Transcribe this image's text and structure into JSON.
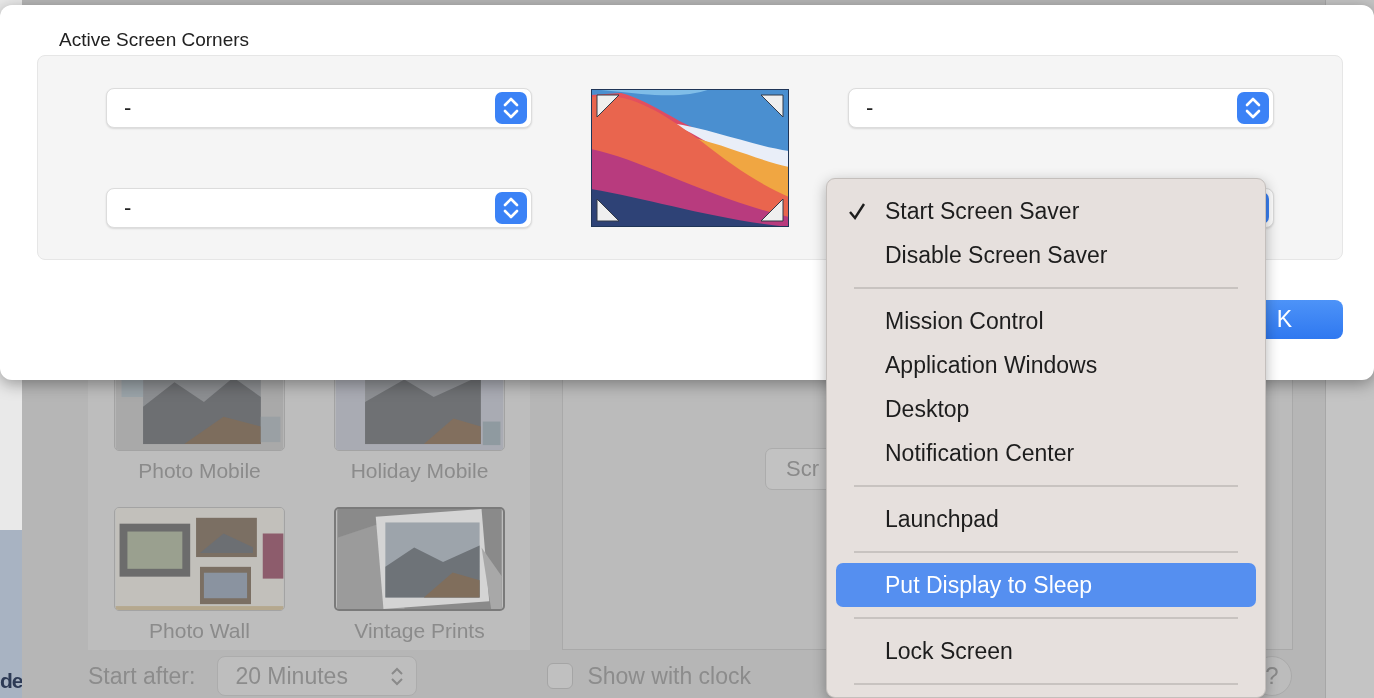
{
  "background": {
    "sidebar_text": "de",
    "savers": [
      {
        "label": "Photo Mobile",
        "selected": false
      },
      {
        "label": "Holiday Mobile",
        "selected": false
      },
      {
        "label": "Photo Wall",
        "selected": false
      },
      {
        "label": "Vintage Prints",
        "selected": true
      }
    ],
    "preview_button": "Scr",
    "start_after": {
      "label": "Start after:",
      "value": "20 Minutes"
    },
    "show_with_clock": {
      "label": "Show with clock",
      "checked": false
    },
    "help_button": "?"
  },
  "sheet": {
    "title": "Active Screen Corners",
    "corner_popups": {
      "left": [
        {
          "kind": "popup",
          "value": "-"
        },
        {
          "kind": "popup",
          "value": "-"
        }
      ],
      "right": [
        {
          "kind": "popup",
          "value": "-"
        },
        {
          "kind": "covered"
        }
      ]
    },
    "ok_button": "K"
  },
  "menu": {
    "items": [
      {
        "kind": "item",
        "label": "Start Screen Saver",
        "checked": true,
        "selected": false
      },
      {
        "kind": "item",
        "label": "Disable Screen Saver",
        "checked": false,
        "selected": false
      },
      {
        "kind": "separator"
      },
      {
        "kind": "item",
        "label": "Mission Control",
        "checked": false,
        "selected": false
      },
      {
        "kind": "item",
        "label": "Application Windows",
        "checked": false,
        "selected": false
      },
      {
        "kind": "item",
        "label": "Desktop",
        "checked": false,
        "selected": false
      },
      {
        "kind": "item",
        "label": "Notification Center",
        "checked": false,
        "selected": false
      },
      {
        "kind": "separator"
      },
      {
        "kind": "item",
        "label": "Launchpad",
        "checked": false,
        "selected": false
      },
      {
        "kind": "separator"
      },
      {
        "kind": "item",
        "label": "Put Display to Sleep",
        "checked": false,
        "selected": true
      },
      {
        "kind": "separator"
      },
      {
        "kind": "item",
        "label": "Lock Screen",
        "checked": false,
        "selected": false
      },
      {
        "kind": "separator"
      }
    ]
  }
}
